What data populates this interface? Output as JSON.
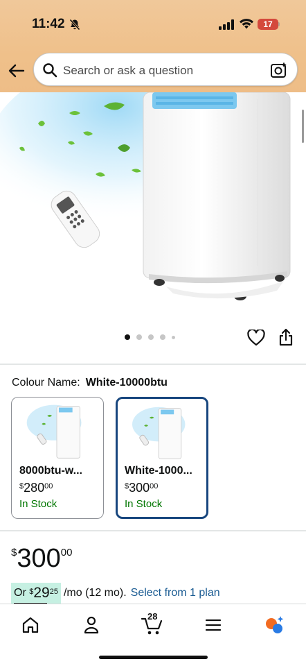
{
  "status_bar": {
    "time": "11:42",
    "battery": "17"
  },
  "search": {
    "placeholder": "Search or ask a question"
  },
  "gallery": {
    "image_count": 5,
    "active_index": 0
  },
  "colour": {
    "label": "Colour Name:",
    "value": "White-10000btu",
    "variants": [
      {
        "name": "8000btu-w...",
        "price_symbol": "$",
        "price_whole": "280",
        "price_fraction": "00",
        "stock": "In Stock",
        "selected": false
      },
      {
        "name": "White-1000...",
        "price_symbol": "$",
        "price_whole": "300",
        "price_fraction": "00",
        "stock": "In Stock",
        "selected": true
      }
    ]
  },
  "price": {
    "symbol": "$",
    "whole": "300",
    "fraction": "00"
  },
  "monthly": {
    "prefix": "Or",
    "symbol": "$",
    "whole": "29",
    "fraction": "25",
    "term": "/mo (12 mo).",
    "link": "Select from 1 plan"
  },
  "bottom_nav": {
    "cart_count": "28"
  },
  "colors": {
    "header": "#efc08a",
    "selected_border": "#17467e",
    "stock_green": "#007600",
    "link_blue": "#1a5b92",
    "highlight": "#c6f0e2"
  }
}
